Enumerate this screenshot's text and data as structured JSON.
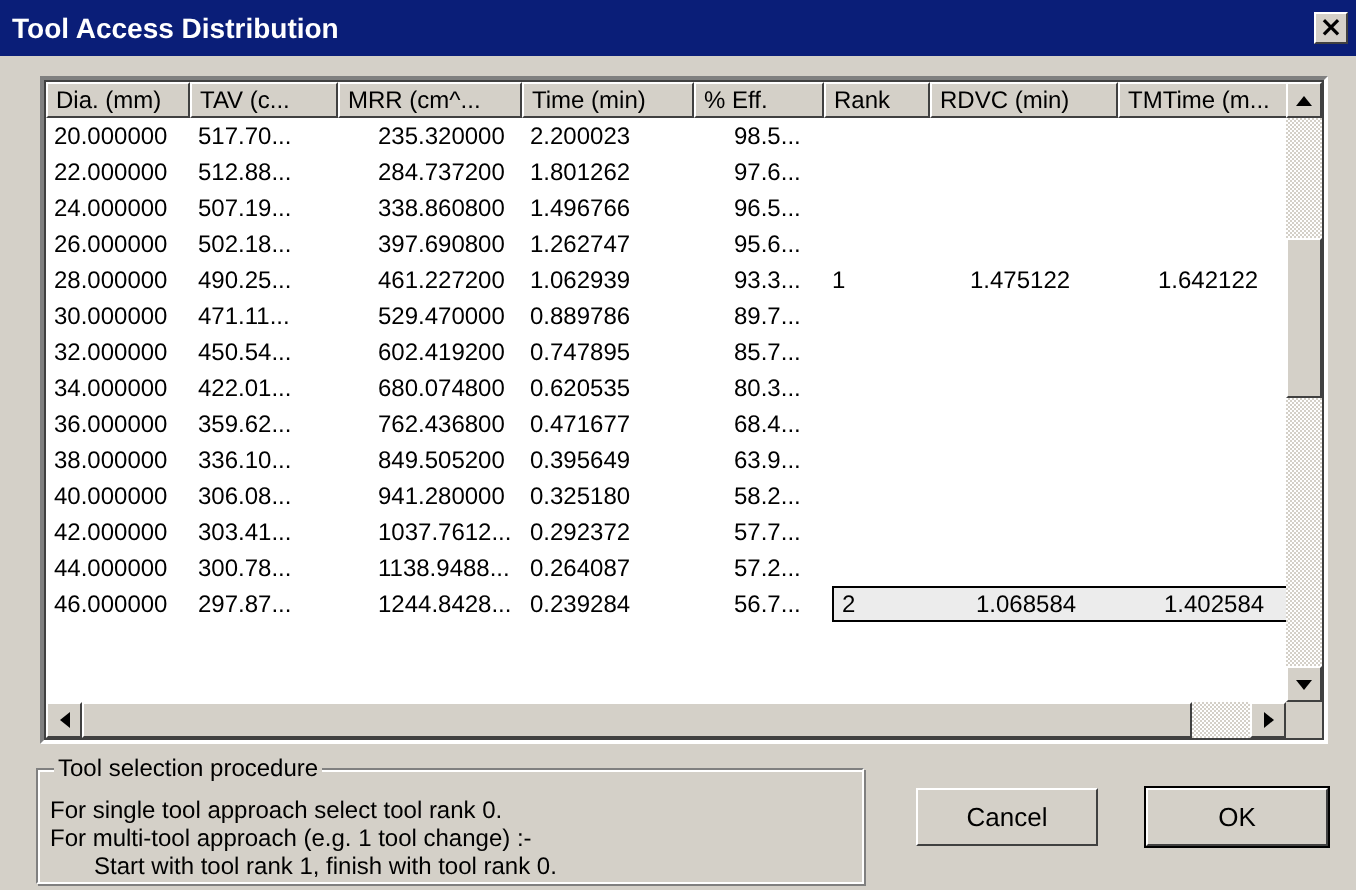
{
  "window": {
    "title": "Tool Access Distribution",
    "close": "×"
  },
  "table": {
    "columns": [
      "Dia. (mm)",
      "TAV (c...",
      "MRR (cm^...",
      "Time (min)",
      "% Eff.",
      "Rank",
      "RDVC (min)",
      "TMTime (m..."
    ],
    "rows": [
      {
        "dia": "20.000000",
        "tav": "517.70...",
        "mrr": "235.320000",
        "time": "2.200023",
        "eff": "98.5...",
        "selected": false
      },
      {
        "dia": "22.000000",
        "tav": "512.88...",
        "mrr": "284.737200",
        "time": "1.801262",
        "eff": "97.6...",
        "selected": false
      },
      {
        "dia": "24.000000",
        "tav": "507.19...",
        "mrr": "338.860800",
        "time": "1.496766",
        "eff": "96.5...",
        "selected": false
      },
      {
        "dia": "26.000000",
        "tav": "502.18...",
        "mrr": "397.690800",
        "time": "1.262747",
        "eff": "95.6...",
        "selected": false
      },
      {
        "dia": "28.000000",
        "tav": "490.25...",
        "mrr": "461.227200",
        "time": "1.062939",
        "eff": "93.3...",
        "rank": "1",
        "rdvc": "1.475122",
        "tmtime": "1.642122",
        "selected": false
      },
      {
        "dia": "30.000000",
        "tav": "471.11...",
        "mrr": "529.470000",
        "time": "0.889786",
        "eff": "89.7...",
        "selected": false
      },
      {
        "dia": "32.000000",
        "tav": "450.54...",
        "mrr": "602.419200",
        "time": "0.747895",
        "eff": "85.7...",
        "selected": false
      },
      {
        "dia": "34.000000",
        "tav": "422.01...",
        "mrr": "680.074800",
        "time": "0.620535",
        "eff": "80.3...",
        "selected": false
      },
      {
        "dia": "36.000000",
        "tav": "359.62...",
        "mrr": "762.436800",
        "time": "0.471677",
        "eff": "68.4...",
        "selected": false
      },
      {
        "dia": "38.000000",
        "tav": "336.10...",
        "mrr": "849.505200",
        "time": "0.395649",
        "eff": "63.9...",
        "selected": false
      },
      {
        "dia": "40.000000",
        "tav": "306.08...",
        "mrr": "941.280000",
        "time": "0.325180",
        "eff": "58.2...",
        "selected": false
      },
      {
        "dia": "42.000000",
        "tav": "303.41...",
        "mrr": "1037.7612...",
        "time": "0.292372",
        "eff": "57.7...",
        "selected": false
      },
      {
        "dia": "44.000000",
        "tav": "300.78...",
        "mrr": "1138.9488...",
        "time": "0.264087",
        "eff": "57.2...",
        "selected": false
      },
      {
        "dia": "46.000000",
        "tav": "297.87...",
        "mrr": "1244.8428...",
        "time": "0.239284",
        "eff": "56.7...",
        "rank": "2",
        "rdvc": "1.068584",
        "tmtime": "1.402584",
        "selected": true
      }
    ]
  },
  "procedure": {
    "title": "Tool selection procedure",
    "lines": [
      "For single tool approach select tool rank 0.",
      "For multi-tool approach (e.g. 1 tool change) :-",
      "Start with tool rank 1, finish with tool rank 0."
    ]
  },
  "buttons": [
    {
      "label": "Cancel",
      "default": false
    },
    {
      "label": "OK",
      "default": true
    }
  ]
}
